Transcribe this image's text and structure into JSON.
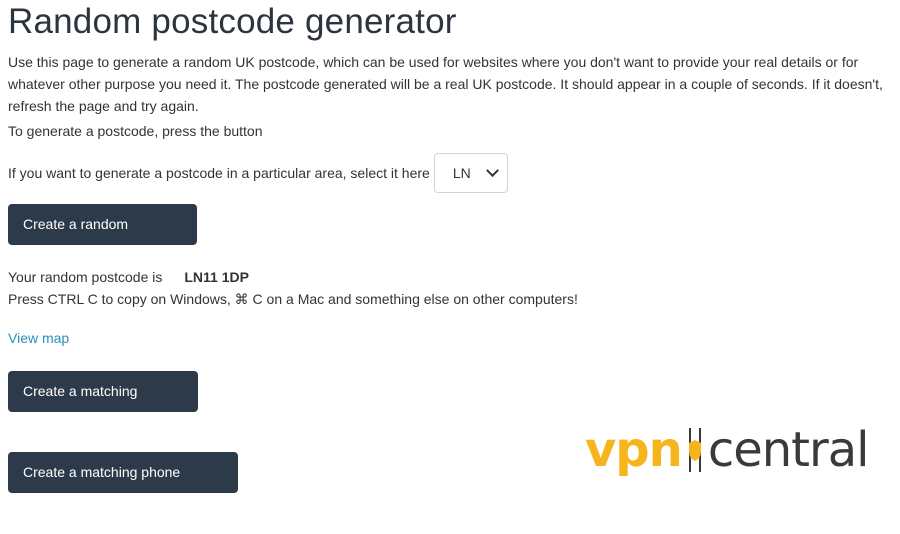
{
  "title": "Random postcode generator",
  "intro": "Use this page to generate a random UK postcode, which can be used for websites where you don't want to provide your real details or for whatever other purpose you need it. The postcode generated will be a real UK postcode. It should appear in a couple of seconds. If it doesn't, refresh the page and try again.",
  "instruction": "To generate a postcode, press the button",
  "area": {
    "label": "If you want to generate a postcode in a particular area, select it here",
    "selected": "LN"
  },
  "buttons": {
    "create_postcode": "Create a random postcode",
    "create_address": "Create a matching address",
    "create_phone": "Create a matching phone number"
  },
  "result": {
    "label": "Your random postcode is",
    "postcode": "LN11 1DP",
    "copy_hint": "Press CTRL C to copy on Windows, ⌘ C on a Mac and something else on other computers!"
  },
  "view_map": "View map",
  "watermark": {
    "part1": "vpn",
    "part2": "central"
  },
  "colors": {
    "button_bg": "#2c3a4a",
    "link": "#2a8fbd",
    "logo_yellow": "#f6b41d",
    "logo_dark": "#3a3a3a"
  }
}
